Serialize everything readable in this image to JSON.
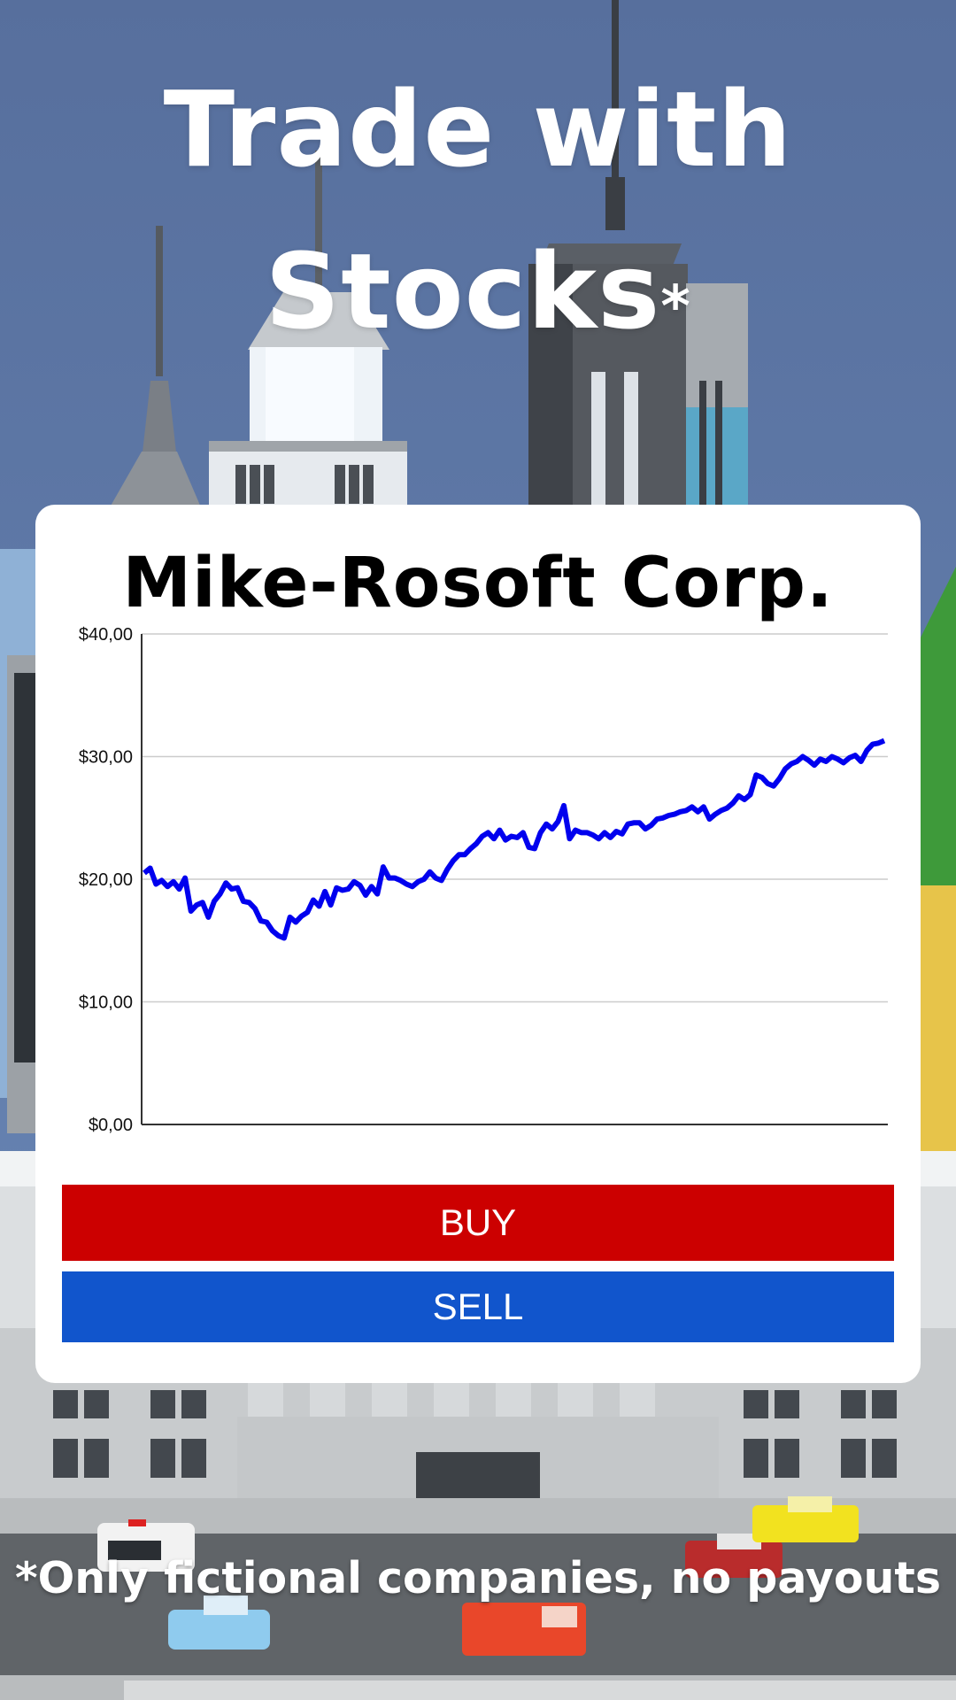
{
  "headline": {
    "line1": "Trade with",
    "line2": "Stocks",
    "asterisk": "*"
  },
  "card": {
    "company": "Mike-Rosoft Corp.",
    "buy_label": "BUY",
    "sell_label": "SELL"
  },
  "disclaimer": "*Only fictional companies, no payouts",
  "colors": {
    "sky": "#5a74a3",
    "buy": "#cc0000",
    "sell": "#1155cc",
    "line": "#0000ee"
  },
  "chart_data": {
    "type": "line",
    "ylim": [
      0,
      40
    ],
    "y_ticks": [
      "$0,00",
      "$10,00",
      "$20,00",
      "$30,00",
      "$40,00"
    ],
    "y_tick_values": [
      0,
      10,
      20,
      30,
      40
    ],
    "grid": true,
    "series": [
      {
        "values": [
          20.5,
          20.9,
          19.6,
          19.9,
          19.4,
          19.8,
          19.2,
          20.1,
          17.4,
          17.9,
          18.1,
          16.9,
          18.2,
          18.8,
          19.7,
          19.2,
          19.3,
          18.2,
          18.1,
          17.6,
          16.6,
          16.5,
          15.8,
          15.4,
          15.2,
          16.9,
          16.5,
          17.0,
          17.3,
          18.3,
          17.8,
          19.0,
          17.9,
          19.3,
          19.1,
          19.2,
          19.8,
          19.5,
          18.7,
          19.4,
          18.8,
          21.0,
          20.1,
          20.1,
          19.9,
          19.6,
          19.4,
          19.8,
          20.0,
          20.6,
          20.1,
          19.9,
          20.8,
          21.5,
          22.0,
          22.0,
          22.5,
          22.9,
          23.5,
          23.8,
          23.3,
          24.0,
          23.2,
          23.5,
          23.4,
          23.8,
          22.6,
          22.5,
          23.8,
          24.5,
          24.1,
          24.7,
          26.0,
          23.3,
          24.0,
          23.8,
          23.8,
          23.6,
          23.3,
          23.8,
          23.4,
          23.9,
          23.7,
          24.5,
          24.6,
          24.6,
          24.1,
          24.4,
          24.9,
          25.0,
          25.2,
          25.3,
          25.5,
          25.6,
          25.9,
          25.5,
          25.9,
          24.9,
          25.3,
          25.6,
          25.8,
          26.2,
          26.8,
          26.5,
          26.9,
          28.5,
          28.3,
          27.8,
          27.6,
          28.2,
          29.0,
          29.4,
          29.6,
          30.0,
          29.7,
          29.3,
          29.8,
          29.6,
          30.0,
          29.8,
          29.5,
          29.9,
          30.1,
          29.6,
          30.5,
          31.0,
          31.1,
          31.3
        ]
      }
    ]
  }
}
